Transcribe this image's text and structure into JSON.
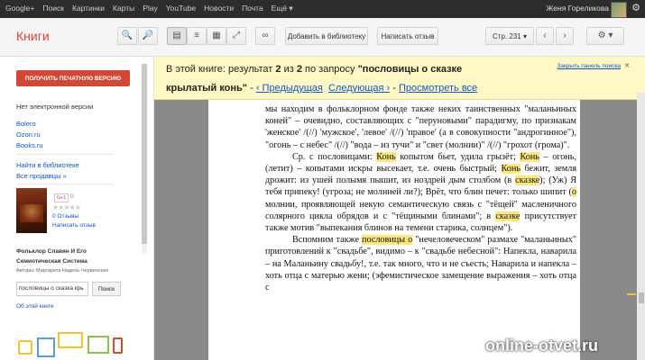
{
  "topnav": {
    "items": [
      "Google+",
      "Поиск",
      "Картинки",
      "Карты",
      "Play",
      "YouTube",
      "Новости",
      "Почта",
      "Ещё ▾"
    ],
    "user": "Женя Горелikова"
  },
  "toolbar": {
    "logo": "Книги",
    "add_to_library": "Добавить в библиотеку",
    "write_review": "Написать отзыв",
    "page_label": "Стр. 231 ▾"
  },
  "sidebar": {
    "print_button": "ПОЛУЧИТЬ ПЕЧАТНУЮ ВЕРСИЮ",
    "no_ebook": "Нет электронной версии",
    "stores": [
      "Bolero",
      "Ozon.ru",
      "Books.ru"
    ],
    "find_in_library": "Найти в библиотеке",
    "all_sellers": "Все продавцы »",
    "gplus_count": "0",
    "reviews_count": "0 Отзывы",
    "write_review": "Написать отзыв",
    "book_title": "Фольклор Славян И Его Семиотическая Система",
    "authors": "Авторы: Маргарита Надель-Червинская",
    "search_value": "пословицы о сказка крь",
    "search_button": "Поиск",
    "about_book": "Об этой книге"
  },
  "banner": {
    "line1_prefix": "В этой книге: результат",
    "result_index": "2",
    "of_word": "из",
    "result_total": "2",
    "query_prefix": "по запросу",
    "query_part1": "\"пословицы о сказке",
    "query_part2": "крылатый конь\"",
    "sep": "-",
    "prev": "‹ Предыдущая",
    "next": "Следующая ›",
    "sep2": "-",
    "view_all": "Просмотреть все",
    "close_panel": "Закрыть панель поиска"
  },
  "page_text": {
    "p1": "мы находим в фольклорном фонде также неких таинственных \"маланьиных коней\" – очевидно, составляющих с \"перуновыми\" парадигму, по признакам 'женское' /(//) 'мужское', 'левое' /(//) 'правое' (а в совокупности \"андрогинное\"), \"огонь – с небес\" /(//) \"вода – из тучи\" и \"свет (молнии)\" /(//) \"грохот (грома)\".",
    "p2_a": "Ср. с пословицами: ",
    "p2_h1": "Конь",
    "p2_b": " копытом бьет, удила грызёт; ",
    "p2_h2": "Конь",
    "p2_c": " – огонь, (летит) – копытами искры высекает, т.е. очень быстрый; ",
    "p2_h3": "Конь",
    "p2_d": " бежит, земля дрожит: из ушей полымя пышит, из ноздрей дым столбом (в ",
    "p2_h4": "сказке",
    "p2_e": "); (Уж) Я тебя припеку! (угроза; не молнией ли?); Врёт, что блин печет: только шипит (",
    "p2_h5": "о",
    "p2_f": " молнии, проявляющей некую семантическую связь с \"тёщей\" масленичного солярного цикла обрядов и с \"тёщиными блинами\"; в ",
    "p2_h6": "сказке",
    "p2_g": " присутствует также мотив \"выпекания блинов на темени старика, солнцем\").",
    "p3_a": "Вспомним также ",
    "p3_h1": "пословицы о",
    "p3_b": " \"нечеловеческом\" размахе \"маланьиных\" приготовлений к \"свадьбе\", видимо – к \"свадьбе небесной\": Напекла, наварила – на Маланьину свадьбу!, т.е. так много, что и не съесть; Наварила и напекла – хоть отца с матерью жени; (эфемистическое замещение выражения – хоть отца с"
  },
  "watermark": "online-otvet.ru",
  "colors": {
    "accent_red": "#d14836",
    "banner_bg": "#fff8c4",
    "highlight": "#fbe77e",
    "link": "#1155cc",
    "topbar": "#2d2d2d"
  }
}
